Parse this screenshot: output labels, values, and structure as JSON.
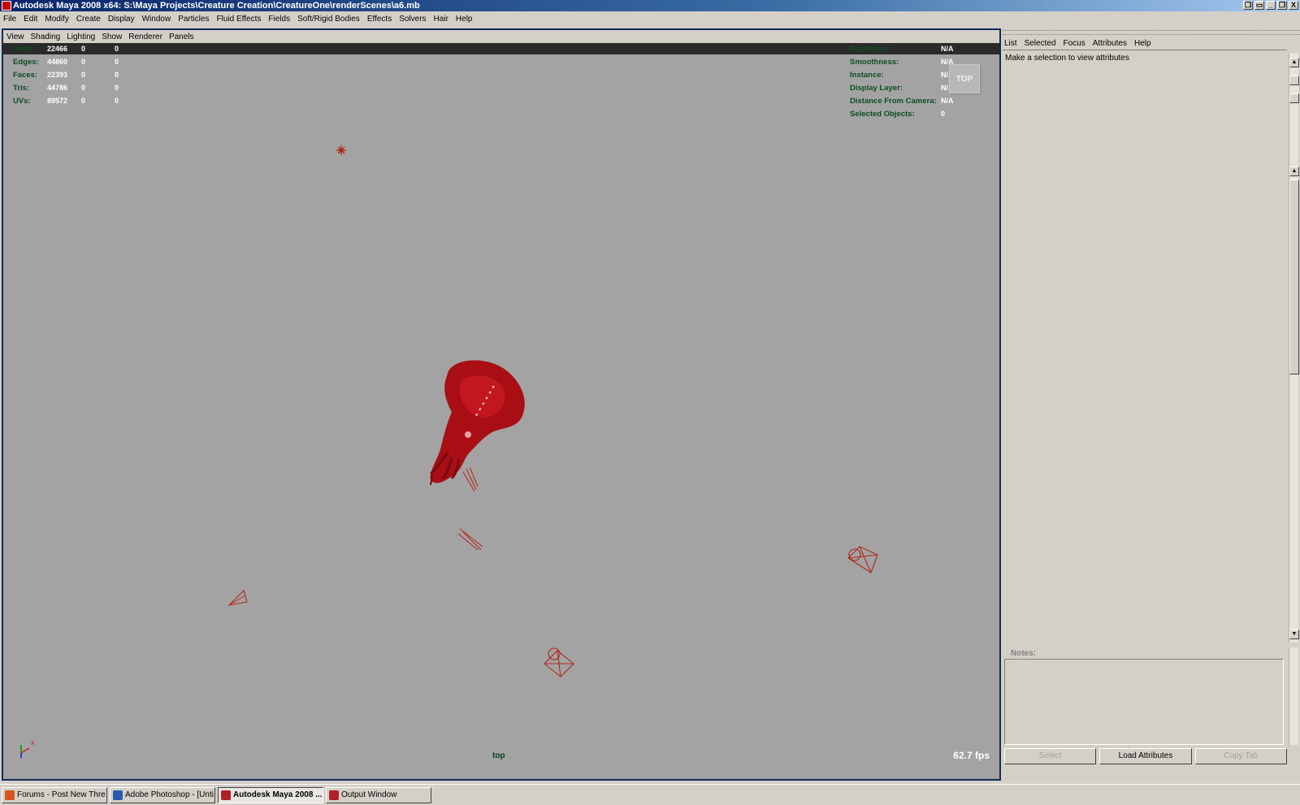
{
  "window": {
    "title": "Autodesk Maya 2008 x64: S:\\Maya Projects\\Creature Creation\\CreatureOne\\renderScenes\\a6.mb",
    "buttons": [
      "❐",
      "▭",
      "_",
      "❐",
      "X"
    ]
  },
  "main_menu": [
    "File",
    "Edit",
    "Modify",
    "Create",
    "Display",
    "Window",
    "Particles",
    "Fluid Effects",
    "Fields",
    "Soft/Rigid Bodies",
    "Effects",
    "Solvers",
    "Hair",
    "Help"
  ],
  "panel_menu": [
    "View",
    "Shading",
    "Lighting",
    "Show",
    "Renderer",
    "Panels"
  ],
  "hud_left": [
    {
      "label": "Verts:",
      "v1": "22466",
      "v2": "0",
      "v3": "0"
    },
    {
      "label": "Edges:",
      "v1": "44860",
      "v2": "0",
      "v3": "0"
    },
    {
      "label": "Faces:",
      "v1": "22393",
      "v2": "0",
      "v3": "0"
    },
    {
      "label": "Tris:",
      "v1": "44786",
      "v2": "0",
      "v3": "0"
    },
    {
      "label": "UVs:",
      "v1": "89572",
      "v2": "0",
      "v3": "0"
    }
  ],
  "hud_right": [
    {
      "label": "Backfaces:",
      "value": "N/A"
    },
    {
      "label": "Smoothness:",
      "value": "N/A"
    },
    {
      "label": "Instance:",
      "value": "N/A"
    },
    {
      "label": "Display Layer:",
      "value": "N/A"
    },
    {
      "label": "Distance From Camera:",
      "value": "N/A"
    },
    {
      "label": "Selected Objects:",
      "value": "0"
    }
  ],
  "view_cube_label": "TOP",
  "camera_name": "top",
  "fps": "62.7 fps",
  "axis": {
    "x": "x",
    "y": "y",
    "z": "z"
  },
  "attr_menu": [
    "List",
    "Selected",
    "Focus",
    "Attributes",
    "Help"
  ],
  "attr_message": "Make a selection to view attributes",
  "notes_label": "Notes:",
  "buttons": {
    "select": "Select",
    "load": "Load Attributes",
    "copy": "Copy Tab"
  },
  "taskbar": [
    {
      "label": "Forums - Post New Thre...",
      "color": "#d9531e"
    },
    {
      "label": "Adobe Photoshop - [Unti...",
      "color": "#2a5caa"
    },
    {
      "label": "Autodesk Maya 2008 ...",
      "color": "#b0202a"
    },
    {
      "label": "Output Window",
      "color": "#b0202a"
    }
  ],
  "colors": {
    "viewport_bg": "#a3a3a3",
    "creature": "#b01018",
    "wire": "#b0281a",
    "hud_label": "#0b4d22"
  }
}
